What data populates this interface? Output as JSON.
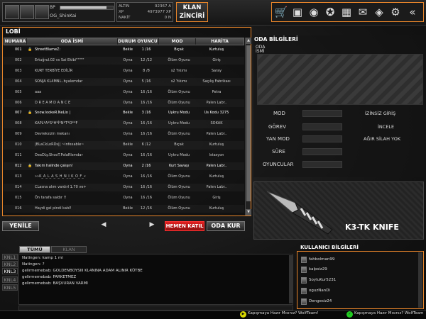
{
  "header": {
    "bp_label": "BP",
    "bp_progress": 0.88,
    "player_name": "OG_ShinKai",
    "stats": [
      {
        "label": "ALTIN",
        "value": "92367 A"
      },
      {
        "label": "XP",
        "value": "4973977 XP"
      },
      {
        "label": "NAKİT",
        "value": "0 N"
      }
    ],
    "klan_button": "KLAN\nZİNCİRİ",
    "icons": [
      "cart-icon",
      "inventory-icon",
      "helmet-icon",
      "wolf-icon",
      "gift-icon",
      "mail-icon",
      "ticket-icon",
      "gear-icon",
      "back-icon"
    ]
  },
  "lobby": {
    "title": "LOBİ",
    "columns": [
      "NUMARA",
      "ODA İSMİ",
      "DURUM",
      "OYUNCU",
      "MOD",
      "HARİTA"
    ],
    "rows": [
      {
        "num": "001",
        "locked": true,
        "name": "StreetBlameZ:",
        "status": "Bekle",
        "players": "1 /16",
        "mode": "Bıçak",
        "map": "Kurtuluş"
      },
      {
        "num": "002",
        "locked": false,
        "name": "Ertuğrul.02 vs Sai Ekibi\"\"\"\"\"",
        "status": "Oyna",
        "players": "12 /12",
        "mode": "Ölüm Oyunu",
        "map": "Giriş"
      },
      {
        "num": "003",
        "locked": false,
        "name": "KURT TERBİYE EDİLİR",
        "status": "Oyna",
        "players": "8 /8",
        "mode": "s2 Yıkımı",
        "map": "Saray"
      },
      {
        "num": "004",
        "locked": false,
        "name": "SONJA KL4MNL..byalemdar",
        "status": "Oyna",
        "players": "5 /16",
        "mode": "s2 Yıkımı",
        "map": "Saçılış Fabrikası"
      },
      {
        "num": "005",
        "locked": false,
        "name": "aaa",
        "status": "Oyna",
        "players": "16 /16",
        "mode": "Ölüm Oyunu",
        "map": "Petra"
      },
      {
        "num": "006",
        "locked": false,
        "name": "D R E A M D A N C E",
        "status": "Oyna",
        "players": "16 /16",
        "mode": "Ölüm Oyunu",
        "map": "Palen Labr.."
      },
      {
        "num": "007",
        "locked": true,
        "name": "Snow.lookeR.NeLio |",
        "status": "Bekle",
        "players": "3 /16",
        "mode": "Uykru Modu",
        "map": "Us Kodu 3275"
      },
      {
        "num": "008",
        "locked": false,
        "name": "KAPL*A*S*H*İ*N*T*O**F",
        "status": "Oyna",
        "players": "16 /16",
        "mode": "Uykru Modu",
        "map": "SOKAK"
      },
      {
        "num": "009",
        "locked": false,
        "name": "Devreksizin mekanı",
        "status": "Oyna",
        "players": "16 /16",
        "mode": "Ölüm Oyunu",
        "map": "Palen Labr.."
      },
      {
        "num": "010",
        "locked": false,
        "name": "|BLaCkLoRDs|| ~infexable~",
        "status": "Bekle",
        "players": "6 /12",
        "mode": "Bıçak",
        "map": "Kurtuluş"
      },
      {
        "num": "011",
        "locked": false,
        "name": "DeaDLy.ShooT.PolaRlsmdar",
        "status": "Oyna",
        "players": "16 /16",
        "mode": "Uykru Modu",
        "map": "Istasyon"
      },
      {
        "num": "012",
        "locked": true,
        "name": "Takım halinde çalışın!",
        "status": "Oyna",
        "players": "2 /16",
        "mode": "Kurt Savaşı",
        "map": "Palen Labr.."
      },
      {
        "num": "013",
        "locked": false,
        "name": "»»K_A_L_A_S_H_N_I_K_O_F_«",
        "status": "Oyna",
        "players": "16 /16",
        "mode": "Ölüm Oyunu",
        "map": "Kurtuluş"
      },
      {
        "num": "014",
        "locked": false,
        "name": "CLasna alım vardırl 1.70 ve+",
        "status": "Oyna",
        "players": "16 /16",
        "mode": "Ölüm Oyunu",
        "map": "Palen Labr.."
      },
      {
        "num": "015",
        "locked": false,
        "name": "Ön tarafa saldır !!",
        "status": "Oyna",
        "players": "16 /16",
        "mode": "Ölüm Oyunu",
        "map": "Giriş"
      },
      {
        "num": "016",
        "locked": false,
        "name": "Haydi gel pindi katıl!",
        "status": "Bekle",
        "players": "12 /16",
        "mode": "Ölüm Oyunu",
        "map": "Kurtuluş"
      }
    ],
    "buttons": {
      "refresh": "YENİLE",
      "join_now": "HEMEN KATIL",
      "create_room": "ODA KUR"
    }
  },
  "room_info": {
    "title": "ODA BİLGİLERİ",
    "subtitle": "ODA\nİSMİ",
    "labels": [
      "MOD",
      "GÖREV",
      "YAN MOD",
      "SÜRE",
      "OYUNCULAR"
    ],
    "values": [
      "İZİNSİZ GİRİŞ",
      "İNCELE",
      "AĞIR SİLAH YOK"
    ]
  },
  "promo": {
    "item_name": "K3-TK KNIFE"
  },
  "chat": {
    "channels": [
      "KNL1",
      "KNL2",
      "KNL3",
      "KNL4",
      "KNL5"
    ],
    "active_channel": 2,
    "tabs": [
      "TÜMÜ",
      "KLAN"
    ],
    "lines": [
      "Natingen: kamp 1 mi",
      "Natingen: ?",
      "gelirmemebab: GOLDENBOYSIII KL4NINA ADAM ALINIR KÜTBE",
      "gelirmemebab: FARKETMEZ",
      "gelirmemebab: BAŞVURAN VARMI"
    ]
  },
  "user_info": {
    "title": "KULLANICI BİLGİLERİ",
    "users": [
      "fahbolman99",
      "kalpsiz29",
      "SoyluKur5231",
      "oguzNanDi",
      "Dengesiz24"
    ]
  },
  "ticker": {
    "messages": [
      "Kapışmaya Hazır Mısınız? WolfTeam!",
      "Kapışmaya Hazır Mısınız? WolfTeam"
    ],
    "colors": [
      "#d8d800",
      "#22cc22"
    ]
  }
}
